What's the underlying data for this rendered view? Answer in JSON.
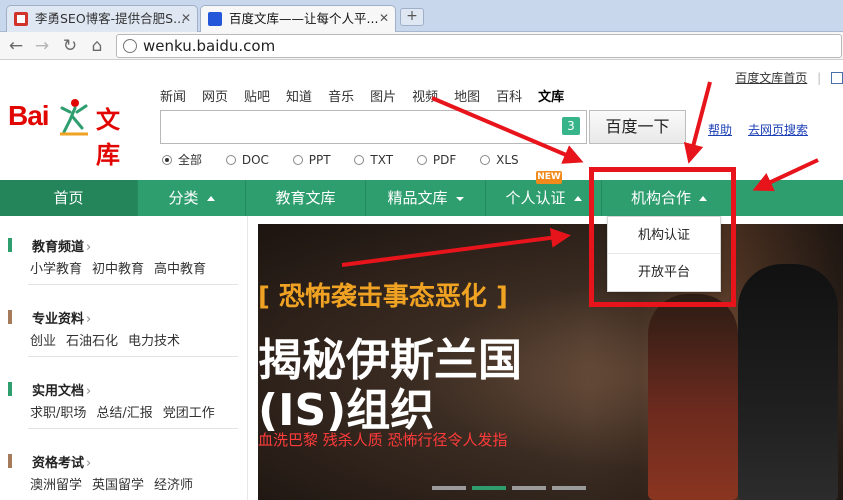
{
  "browser": {
    "tabs": [
      {
        "title": "李勇SEO博客-提供合肥S...",
        "active": false
      },
      {
        "title": "百度文库——让每个人平...",
        "active": true
      }
    ],
    "url": "wenku.baidu.com"
  },
  "top_links": {
    "home": "百度文库首页"
  },
  "logo": {
    "text": "Bai",
    "product": "文库"
  },
  "search_nav": [
    "新闻",
    "网页",
    "贴吧",
    "知道",
    "音乐",
    "图片",
    "视频",
    "地图",
    "百科",
    "文库"
  ],
  "search": {
    "badge": "3",
    "button": "百度一下",
    "help": "帮助",
    "go_web": "去网页搜索"
  },
  "file_types": [
    "全部",
    "DOC",
    "PPT",
    "TXT",
    "PDF",
    "XLS"
  ],
  "main_nav": [
    {
      "label": "首页"
    },
    {
      "label": "分类"
    },
    {
      "label": "教育文库"
    },
    {
      "label": "精品文库"
    },
    {
      "label": "个人认证",
      "badge": "NEW"
    },
    {
      "label": "机构合作"
    }
  ],
  "dropdown": [
    "机构认证",
    "开放平台"
  ],
  "sidebar": [
    {
      "title": "教育频道",
      "links": [
        "小学教育",
        "初中教育",
        "高中教育"
      ],
      "color": "#2e9e6f"
    },
    {
      "title": "专业资料",
      "links": [
        "创业",
        "石油石化",
        "电力技术"
      ],
      "color": "#a57b5b"
    },
    {
      "title": "实用文档",
      "links": [
        "求职/职场",
        "总结/汇报",
        "党团工作"
      ],
      "color": "#2e9e6f"
    },
    {
      "title": "资格考试",
      "links": [
        "澳洲留学",
        "英国留学",
        "经济师"
      ],
      "color": "#a57b5b"
    }
  ],
  "banner": {
    "tag": "[ 恐怖袭击事态恶化 ]",
    "headline1": "揭秘伊斯兰国",
    "headline2": "(IS)组织",
    "sub": "血洗巴黎 残杀人质 恐怖行径令人发指"
  },
  "accent_color": "#2e9e6f",
  "annotation_color": "#e8141b"
}
